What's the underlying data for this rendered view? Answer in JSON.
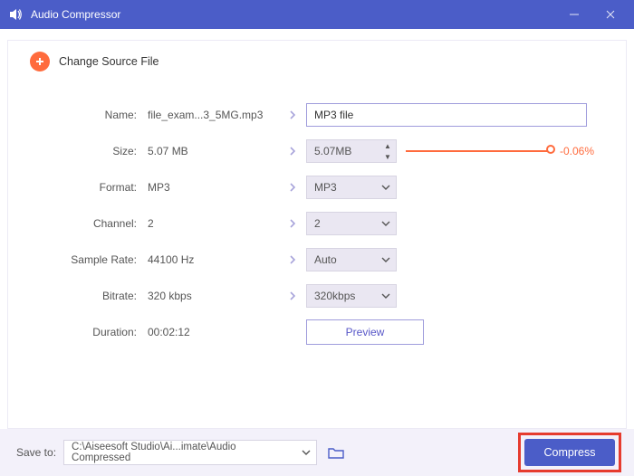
{
  "window": {
    "title": "Audio Compressor"
  },
  "topbar": {
    "change_source_label": "Change Source File"
  },
  "labels": {
    "name": "Name:",
    "size": "Size:",
    "format": "Format:",
    "channel": "Channel:",
    "sample_rate": "Sample Rate:",
    "bitrate": "Bitrate:",
    "duration": "Duration:"
  },
  "source": {
    "name": "file_exam...3_5MG.mp3",
    "size": "5.07 MB",
    "format": "MP3",
    "channel": "2",
    "sample_rate": "44100 Hz",
    "bitrate": "320 kbps",
    "duration": "00:02:12"
  },
  "target": {
    "name_value": "MP3 file",
    "size_value": "5.07MB",
    "size_delta": "-0.06%",
    "format": "MP3",
    "channel": "2",
    "sample_rate": "Auto",
    "bitrate": "320kbps"
  },
  "buttons": {
    "preview": "Preview",
    "compress": "Compress"
  },
  "footer": {
    "save_to_label": "Save to:",
    "save_path": "C:\\Aiseesoft Studio\\Ai...imate\\Audio Compressed"
  }
}
